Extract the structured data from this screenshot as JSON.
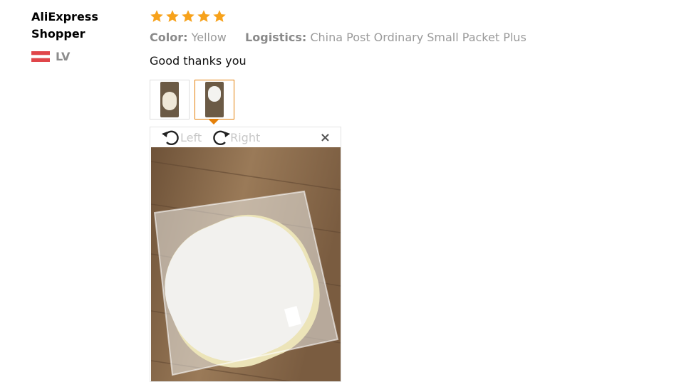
{
  "reviewer": {
    "name": "AliExpress Shopper",
    "country_code": "LV"
  },
  "review": {
    "rating": 5,
    "color_label": "Color:",
    "color_value": "Yellow",
    "logistics_label": "Logistics:",
    "logistics_value": "China Post Ordinary Small Packet Plus",
    "text": "Good thanks you"
  },
  "viewer": {
    "rotate_left": "Left",
    "rotate_right": "Right",
    "close": "×"
  },
  "colors": {
    "star": "#f7a21b",
    "accent": "#e4800a",
    "wood": "#8a6a4c"
  }
}
